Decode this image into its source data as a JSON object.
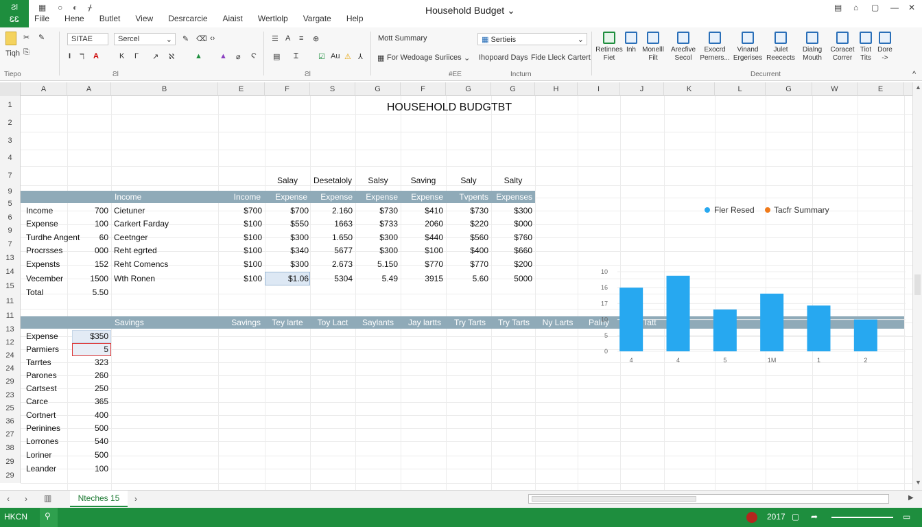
{
  "app": {
    "logo_line1": "Ƨl",
    "logo_line2": "ᏋᏋ",
    "doc_title": "Household Budget",
    "menu": [
      "Fiile",
      "Hene",
      "Butlet",
      "View",
      "Desrcarcie",
      "Aiaist",
      "Wertlolp",
      "Vargate",
      "Help"
    ]
  },
  "ribbon": {
    "paste_label": "Tiqh",
    "font_name": "ЅITAE",
    "font_style": "Sercel",
    "num_format_1": "Mott Summary",
    "num_format_2": "Sertieis",
    "row2_item1": "For Wedoage Suriices",
    "row2_item2": "Ihopoard Days",
    "row2_item3": "Fide Lleck Cartert",
    "group_labels": [
      "Tiepo",
      "Ƨl",
      "#ЕЕ",
      "Incturn",
      "Decurrent"
    ],
    "big_buttons": [
      {
        "l1": "Retinnes",
        "l2": "Fiet"
      },
      {
        "l1": "Inh",
        "l2": ""
      },
      {
        "l1": "Monelll",
        "l2": "Filt"
      },
      {
        "l1": "Arecfive",
        "l2": "Secol"
      },
      {
        "l1": "Exocrd",
        "l2": "Perners..."
      },
      {
        "l1": "Vinand",
        "l2": "Ergerises"
      },
      {
        "l1": "Julet",
        "l2": "Reecects"
      },
      {
        "l1": "Dialng",
        "l2": "Mouth"
      },
      {
        "l1": "Coracet",
        "l2": "Correr"
      },
      {
        "l1": "Tiot",
        "l2": "Tits"
      },
      {
        "l1": "Dore",
        "l2": "->"
      }
    ]
  },
  "columns": [
    "A",
    "A",
    "B",
    "E",
    "F",
    "S",
    "G",
    "F",
    "G",
    "G",
    "H",
    "I",
    "J",
    "K",
    "L",
    "G",
    "W",
    "E"
  ],
  "rows": [
    "1",
    "2",
    "3",
    "4",
    "7",
    "9",
    "5",
    "6",
    "9",
    "7",
    "13",
    "14",
    "15",
    "11",
    "11",
    "13",
    "12",
    "24",
    "24",
    "29",
    "23",
    "25",
    "36",
    "27",
    "38",
    "29",
    "29"
  ],
  "sheet": {
    "title": "HOUSEHOLD BUDGTBT",
    "top_headers": [
      "Salay",
      "Desetaloly",
      "Salsy",
      "Saving",
      "Saly",
      "Salty"
    ],
    "band1": [
      "Income",
      "Income",
      "Expense",
      "Expense",
      "Expense",
      "Expense",
      "Tvpents",
      "Expenses"
    ],
    "table1": [
      {
        "name": "Income",
        "val": "700",
        "desc": "Cietuner",
        "c": [
          "$700",
          "$700",
          "2.160",
          "$730",
          "$410",
          "$730",
          "$300"
        ]
      },
      {
        "name": "Expense",
        "val": "100",
        "desc": "Carkert Farday",
        "c": [
          "$100",
          "$550",
          "1663",
          "$733",
          "2060",
          "$220",
          "$000"
        ]
      },
      {
        "name": "Turdhe Angent",
        "val": "60",
        "desc": "Ceetnger",
        "c": [
          "$100",
          "$300",
          "1.650",
          "$300",
          "$440",
          "$560",
          "$760"
        ]
      },
      {
        "name": "Procrsses",
        "val": "000",
        "desc": "Reht egrted",
        "c": [
          "$100",
          "$340",
          "5677",
          "$300",
          "$100",
          "$400",
          "$660"
        ]
      },
      {
        "name": "Expensts",
        "val": "152",
        "desc": "Reht Comencs",
        "c": [
          "$100",
          "$300",
          "2.673",
          "5.150",
          "$770",
          "$770",
          "$200"
        ]
      },
      {
        "name": "Vecember",
        "val": "1500",
        "desc": "Wth Ronen",
        "c": [
          "$100",
          "$1.06",
          "5304",
          "5.49",
          "3915",
          "5.60",
          "5000"
        ]
      }
    ],
    "total_label": "Total",
    "total_value": "5.50",
    "band2": [
      "Savings",
      "Savings",
      "Tey larte",
      "Toy Lact",
      "Saylants",
      "Jay lartts",
      "Try Tarts",
      "Try Tarts",
      "Ny Larts",
      "Palny",
      "Tay Tatt"
    ],
    "table2": [
      {
        "name": "Expense",
        "val": "$350"
      },
      {
        "name": "Parmiers",
        "val": "5"
      },
      {
        "name": "Tarrtes",
        "val": "323"
      },
      {
        "name": "Parones",
        "val": "260"
      },
      {
        "name": "Cartsest",
        "val": "250"
      },
      {
        "name": "Carce",
        "val": "365"
      },
      {
        "name": "Cortnert",
        "val": "400"
      },
      {
        "name": "Perinines",
        "val": "500"
      },
      {
        "name": "Lorrones",
        "val": "540"
      },
      {
        "name": "Loriner",
        "val": "500"
      },
      {
        "name": "Leander",
        "val": "100"
      }
    ]
  },
  "chart_data": {
    "type": "bar",
    "categories": [
      "4",
      "4",
      "5",
      "1M",
      "1",
      "2"
    ],
    "series": [
      {
        "name": "Fler Resed",
        "values": [
          16,
          19,
          10.5,
          14.5,
          11.5,
          8
        ]
      }
    ],
    "legend": [
      "Fler Resed",
      "Tacfr Summary"
    ],
    "yticks": [
      "0",
      "5",
      "10",
      "17",
      "16",
      "10"
    ],
    "ylim": [
      0,
      20
    ],
    "legend_position": "top-right",
    "colors": {
      "bar": "#27a8f0",
      "legend1": "#27a8f0",
      "legend2": "#f07a1a"
    }
  },
  "sheetbar": {
    "tab": "Nteches 15"
  },
  "status": {
    "left": "HKCN",
    "zoom": "2017"
  },
  "colors": {
    "accent": "#1e8e3e",
    "band": "#8faab8"
  }
}
